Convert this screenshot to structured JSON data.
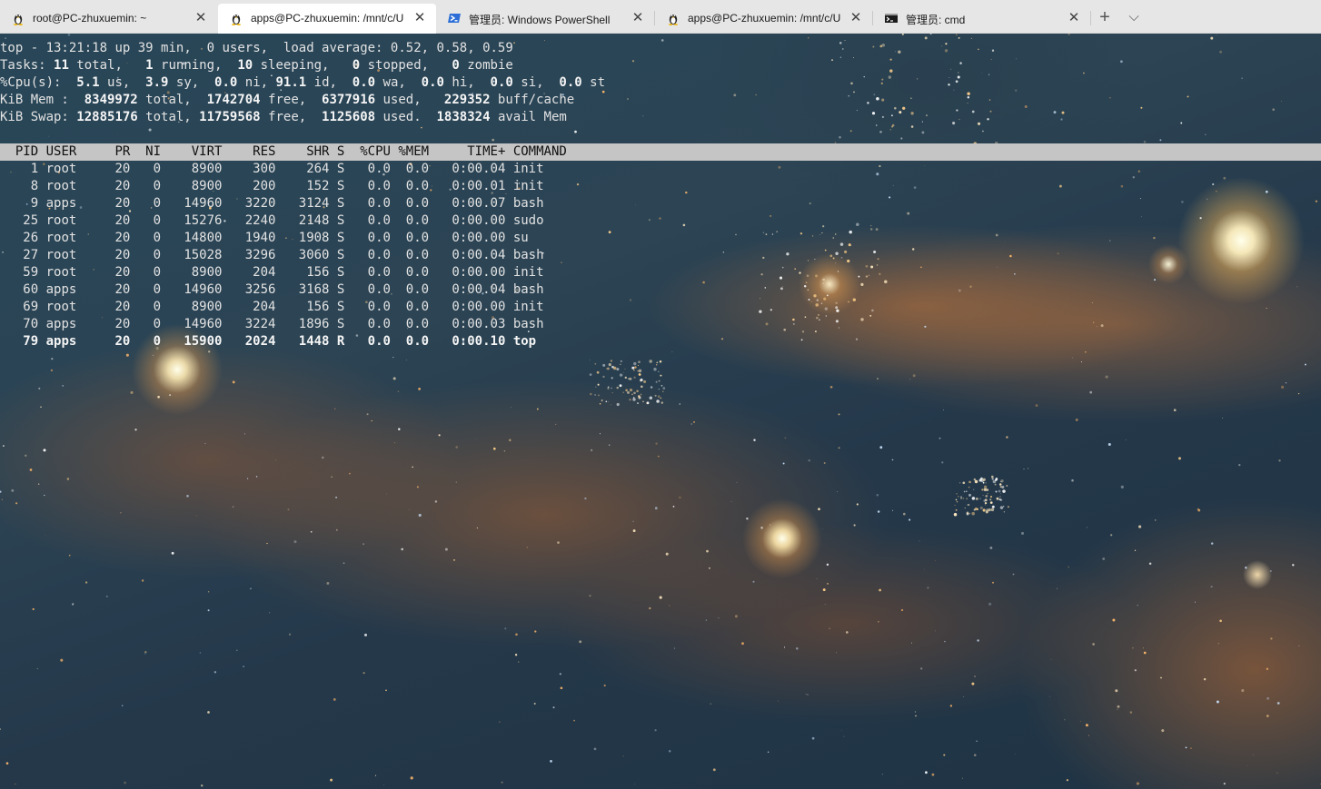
{
  "tabs": [
    {
      "title": "root@PC-zhuxuemin: ~",
      "icon": "linux-penguin-icon",
      "active": false
    },
    {
      "title": "apps@PC-zhuxuemin: /mnt/c/U",
      "icon": "linux-penguin-icon",
      "active": true
    },
    {
      "title": "管理员: Windows PowerShell",
      "icon": "powershell-icon",
      "active": false
    },
    {
      "title": "apps@PC-zhuxuemin: /mnt/c/U",
      "icon": "linux-penguin-icon",
      "active": false
    },
    {
      "title": "管理员: cmd",
      "icon": "cmd-icon",
      "active": false
    }
  ],
  "tabbar": {
    "close_glyph": "✕",
    "new_tab_glyph": "+",
    "dropdown_glyph": "⌵"
  },
  "summary": {
    "uptime": {
      "time": "13:21:18",
      "up": "39 min",
      "users": "0",
      "load": "0.52, 0.58, 0.59"
    },
    "tasks": {
      "total": "11",
      "running": "1",
      "sleeping": "10",
      "stopped": "0",
      "zombie": "0"
    },
    "cpu": {
      "us": "5.1",
      "sy": "3.9",
      "ni": "0.0",
      "id": "91.1",
      "wa": "0.0",
      "hi": "0.0",
      "si": "0.0",
      "st": "0.0"
    },
    "mem": {
      "total": "8349972",
      "free": "1742704",
      "used": "6377916",
      "buff_cache": "229352"
    },
    "swap": {
      "total": "12885176",
      "free": "11759568",
      "used": "1125608",
      "avail": "1838324"
    }
  },
  "table": {
    "columns": [
      "PID",
      "USER",
      "PR",
      "NI",
      "VIRT",
      "RES",
      "SHR",
      "S",
      "%CPU",
      "%MEM",
      "TIME+",
      "COMMAND"
    ],
    "rows": [
      {
        "pid": "1",
        "user": "root",
        "pr": "20",
        "ni": "0",
        "virt": "8900",
        "res": "300",
        "shr": "264",
        "s": "S",
        "cpu": "0.0",
        "mem": "0.0",
        "time": "0:00.04",
        "command": "init"
      },
      {
        "pid": "8",
        "user": "root",
        "pr": "20",
        "ni": "0",
        "virt": "8900",
        "res": "200",
        "shr": "152",
        "s": "S",
        "cpu": "0.0",
        "mem": "0.0",
        "time": "0:00.01",
        "command": "init"
      },
      {
        "pid": "9",
        "user": "apps",
        "pr": "20",
        "ni": "0",
        "virt": "14960",
        "res": "3220",
        "shr": "3124",
        "s": "S",
        "cpu": "0.0",
        "mem": "0.0",
        "time": "0:00.07",
        "command": "bash"
      },
      {
        "pid": "25",
        "user": "root",
        "pr": "20",
        "ni": "0",
        "virt": "15276",
        "res": "2240",
        "shr": "2148",
        "s": "S",
        "cpu": "0.0",
        "mem": "0.0",
        "time": "0:00.00",
        "command": "sudo"
      },
      {
        "pid": "26",
        "user": "root",
        "pr": "20",
        "ni": "0",
        "virt": "14800",
        "res": "1940",
        "shr": "1908",
        "s": "S",
        "cpu": "0.0",
        "mem": "0.0",
        "time": "0:00.00",
        "command": "su"
      },
      {
        "pid": "27",
        "user": "root",
        "pr": "20",
        "ni": "0",
        "virt": "15028",
        "res": "3296",
        "shr": "3060",
        "s": "S",
        "cpu": "0.0",
        "mem": "0.0",
        "time": "0:00.04",
        "command": "bash"
      },
      {
        "pid": "59",
        "user": "root",
        "pr": "20",
        "ni": "0",
        "virt": "8900",
        "res": "204",
        "shr": "156",
        "s": "S",
        "cpu": "0.0",
        "mem": "0.0",
        "time": "0:00.00",
        "command": "init"
      },
      {
        "pid": "60",
        "user": "apps",
        "pr": "20",
        "ni": "0",
        "virt": "14960",
        "res": "3256",
        "shr": "3168",
        "s": "S",
        "cpu": "0.0",
        "mem": "0.0",
        "time": "0:00.04",
        "command": "bash"
      },
      {
        "pid": "69",
        "user": "root",
        "pr": "20",
        "ni": "0",
        "virt": "8900",
        "res": "204",
        "shr": "156",
        "s": "S",
        "cpu": "0.0",
        "mem": "0.0",
        "time": "0:00.00",
        "command": "init"
      },
      {
        "pid": "70",
        "user": "apps",
        "pr": "20",
        "ni": "0",
        "virt": "14960",
        "res": "3224",
        "shr": "1896",
        "s": "S",
        "cpu": "0.0",
        "mem": "0.0",
        "time": "0:00.03",
        "command": "bash"
      },
      {
        "pid": "79",
        "user": "apps",
        "pr": "20",
        "ni": "0",
        "virt": "15900",
        "res": "2024",
        "shr": "1448",
        "s": "R",
        "cpu": "0.0",
        "mem": "0.0",
        "time": "0:00.10",
        "command": "top"
      }
    ]
  },
  "colors": {
    "tab_bar": "#e6e6e6",
    "active_tab": "#ffffff",
    "header_row_bg": "#c5c5c5",
    "terminal_text": "#e2e2e2",
    "powershell_blue": "#2d6fd6"
  }
}
